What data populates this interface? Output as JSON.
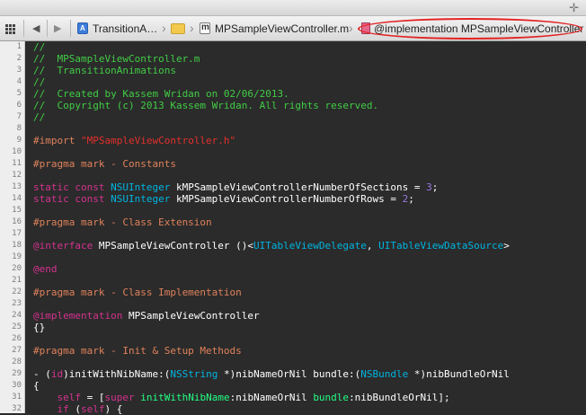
{
  "jumpbar": {
    "crumbs": [
      "TransitionA…",
      "MPSampleViewController.m",
      "@implementation MPSampleViewController"
    ]
  },
  "line_numbers": [
    "1",
    "2",
    "3",
    "4",
    "5",
    "6",
    "7",
    "8",
    "9",
    "10",
    "11",
    "12",
    "13",
    "14",
    "15",
    "16",
    "17",
    "18",
    "19",
    "20",
    "21",
    "22",
    "23",
    "24",
    "25",
    "26",
    "27",
    "28",
    "29",
    "30",
    "31",
    "32"
  ],
  "code": {
    "l1": "//",
    "l2": "//  MPSampleViewController.m",
    "l3": "//  TransitionAnimations",
    "l4": "//",
    "l5": "//  Created by Kassem Wridan on 02/06/2013.",
    "l6": "//  Copyright (c) 2013 Kassem Wridan. All rights reserved.",
    "l7": "//",
    "l9_directive": "#import ",
    "l9_string": "\"MPSampleViewController.h\"",
    "l11": "#pragma mark - Constants",
    "static_const": "static const ",
    "nsuinteger": "NSUInteger",
    "l13_name": " kMPSampleViewControllerNumberOfSections = ",
    "l13_num": "3",
    "semi": ";",
    "l14_name": " kMPSampleViewControllerNumberOfRows = ",
    "l14_num": "2",
    "l16": "#pragma mark - Class Extension",
    "interface_kw": "@interface",
    "l18_class": " MPSampleViewController ()<",
    "l18_proto1": "UITableViewDelegate",
    "comma": ", ",
    "l18_proto2": "UITableViewDataSource",
    "l18_end": ">",
    "l20": "@end",
    "l22": "#pragma mark - Class Implementation",
    "impl_kw": "@implementation",
    "l24_class": " MPSampleViewController",
    "l25": "{}",
    "l27": "#pragma mark - Init & Setup Methods",
    "l29_a": "- (",
    "id_kw": "id",
    "l29_b": ")initWithNibName:(",
    "nsstring": "NSString",
    "l29_c": " *)nibNameOrNil bundle:(",
    "nsbundle": "NSBundle",
    "l29_d": " *)nibBundleOrNil",
    "l30": "{",
    "self_kw": "self",
    "l31_b": " = [",
    "super_kw": "super",
    "l31_sp": " ",
    "l31_m1": "initWithNibName",
    "l31_c": ":nibNameOrNil ",
    "l31_m2": "bundle",
    "l31_d": ":nibBundleOrNil];",
    "if_kw": "if",
    "l32_b": " (",
    "l32_c": ") {"
  }
}
